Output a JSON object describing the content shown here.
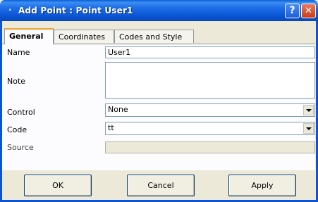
{
  "window": {
    "title": "Add Point : Point User1",
    "help_glyph": "?",
    "close_glyph": "✕"
  },
  "tabs": [
    {
      "label": "General",
      "active": true
    },
    {
      "label": "Coordinates",
      "active": false
    },
    {
      "label": "Codes and Style",
      "active": false
    }
  ],
  "form": {
    "name_label": "Name",
    "name_value": "User1",
    "note_label": "Note",
    "note_value": "",
    "control_label": "Control",
    "control_value": "None",
    "code_label": "Code",
    "code_value": "tt",
    "source_label": "Source",
    "source_value": ""
  },
  "buttons": {
    "ok": "OK",
    "cancel": "Cancel",
    "apply": "Apply"
  },
  "colors": {
    "title_bar": "#0a55d4",
    "dialog_bg": "#ece9d8",
    "active_tab_accent": "#f0a030"
  }
}
